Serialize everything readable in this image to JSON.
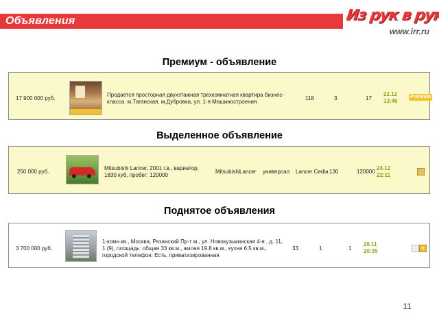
{
  "header": {
    "title": "Объявления",
    "logo_text": "Из рук в руки",
    "logo_url": "www.irr.ru"
  },
  "sections": [
    {
      "heading": "Премиум - объявление",
      "price": "17 900 000 руб.",
      "description": "Продается просторная двухэтажная трехкомнатная квартира бизнес-класса. м.Таганская, м.Дубровка, ул. 1-я Машиностроения",
      "col1": "118",
      "col2": "3",
      "col3": "17",
      "date": "22.12",
      "time": "13:46",
      "badge": "Premium"
    },
    {
      "heading": "Выделенное объявление",
      "price": "250 000 руб.",
      "description": "Mitsubishi Lancer, 2001 г.в., вариатор, 1830 куб, пробег: 120000",
      "make": "Mitsubishi",
      "model": "Lancer",
      "body": "универсал",
      "variant": "Lancer Cedia",
      "power": "130",
      "mileage": "120000",
      "date": "24.12",
      "time": "22:11"
    },
    {
      "heading": "Поднятое объявления",
      "price": "3 700 000 руб.",
      "description": "1-комн.кв., Москва, Рязанский Пр-т м., ул. Новокузьминская 4-я , д. 11, 1 (9), площадь: общая 33 кв.м., жилая 19.8 кв.м., кухня 6.5 кв.м., городской телефон: Есть, приватизированная",
      "col1": "33",
      "col2": "1",
      "col3": "1",
      "date": "26.11",
      "time": "20:35"
    }
  ],
  "footer": {
    "page_number": "11"
  },
  "colors": {
    "brand_red": "#e8393a",
    "card_yellow": "#fbf9c9",
    "date_green": "#8aa617"
  }
}
